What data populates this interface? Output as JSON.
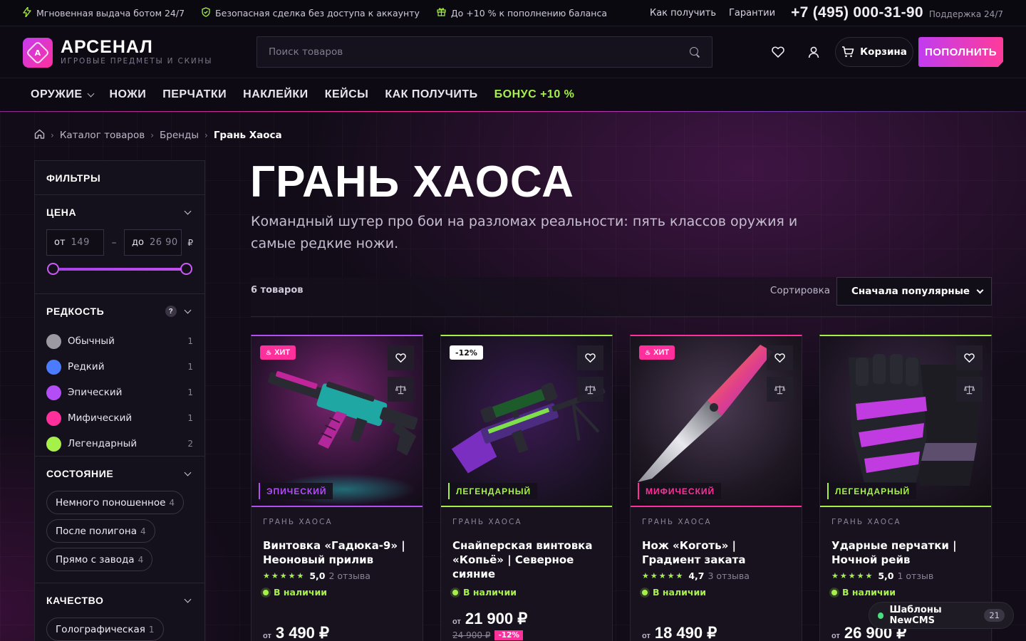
{
  "topbar": {
    "items": [
      "Мгновенная выдача ботом 24/7",
      "Безопасная сделка без доступа к аккаунту",
      "До +10 % к пополнению баланса"
    ],
    "links": [
      "Как получить",
      "Гарантии"
    ],
    "phone": "+7 (495) 000-31-90",
    "support": "Поддержка 24/7"
  },
  "header": {
    "logo_letter": "A",
    "brand": "АРСЕНАЛ",
    "tagline": "ИГРОВЫЕ ПРЕДМЕТЫ И СКИНЫ",
    "search_placeholder": "Поиск товаров",
    "cart_label": "Корзина",
    "topup_label": "ПОПОЛНИТЬ"
  },
  "nav": {
    "items": [
      "ОРУЖИЕ",
      "НОЖИ",
      "ПЕРЧАТКИ",
      "НАКЛЕЙКИ",
      "КЕЙСЫ",
      "КАК ПОЛУЧИТЬ"
    ],
    "bonus": "БОНУС +10 %"
  },
  "breadcrumb": [
    "Каталог товаров",
    "Бренды",
    "Грань Хаоса"
  ],
  "sidebar": {
    "title": "ФИЛЬТРЫ",
    "price": {
      "title": "ЦЕНА",
      "from_label": "от",
      "from_value": "149",
      "to_label": "до",
      "to_value": "26 90",
      "currency": "₽",
      "range_fraction": [
        0.0,
        1.0
      ]
    },
    "rarity": {
      "title": "РЕДКОСТЬ",
      "help": "?",
      "items": [
        {
          "label": "Обычный",
          "count": "1",
          "color": "#9c99a3"
        },
        {
          "label": "Редкий",
          "count": "1",
          "color": "#4b7bff"
        },
        {
          "label": "Эпический",
          "count": "1",
          "color": "#b34df5"
        },
        {
          "label": "Мифический",
          "count": "1",
          "color": "#ff2f9c"
        },
        {
          "label": "Легендарный",
          "count": "2",
          "color": "#a6f04a"
        }
      ]
    },
    "condition": {
      "title": "СОСТОЯНИЕ",
      "items": [
        {
          "label": "Немного поношенное",
          "count": "4"
        },
        {
          "label": "После полигона",
          "count": "4"
        },
        {
          "label": "Прямо с завода",
          "count": "4"
        }
      ]
    },
    "quality": {
      "title": "КАЧЕСТВО",
      "items": [
        {
          "label": "Голографическая",
          "count": "1"
        }
      ]
    }
  },
  "main": {
    "title": "ГРАНЬ ХАОСА",
    "description": "Командный шутер про бои на разломах реальности: пять классов оружия и самые редкие ножи.",
    "count": "6 товаров",
    "sort_label": "Сортировка",
    "sort_value": "Сначала популярные"
  },
  "products": [
    {
      "badge": "ХИТ",
      "badge_type": "hit",
      "rarity": "ЭПИЧЕСКИЙ",
      "rarity_color": "#b34df5",
      "brand": "ГРАНЬ ХАОСА",
      "name": "Винтовка «Гадюка-9» | Неоновый прилив",
      "stars": "★★★★★",
      "rating": "5,0",
      "reviews": "2 отзыва",
      "stock": "В наличии",
      "price_from": "от",
      "price": "3 490 ₽"
    },
    {
      "badge": "-12%",
      "badge_type": "discount",
      "rarity": "ЛЕГЕНДАРНЫЙ",
      "rarity_color": "#a6f04a",
      "brand": "ГРАНЬ ХАОСА",
      "name": "Снайперская винтовка «Копьё» | Северное сияние",
      "stock": "В наличии",
      "price_from": "от",
      "price": "21 900 ₽",
      "old_price": "24 900 ₽",
      "discount": "-12%"
    },
    {
      "badge": "ХИТ",
      "badge_type": "hit",
      "rarity": "МИФИЧЕСКИЙ",
      "rarity_color": "#ff2f9c",
      "brand": "ГРАНЬ ХАОСА",
      "name": "Нож «Коготь» | Градиент заката",
      "stars": "★★★★★",
      "rating": "4,7",
      "reviews": "3 отзыва",
      "stock": "В наличии",
      "price_from": "от",
      "price": "18 490 ₽"
    },
    {
      "rarity": "ЛЕГЕНДАРНЫЙ",
      "rarity_color": "#a6f04a",
      "brand": "ГРАНЬ ХАОСА",
      "name": "Ударные перчатки | Ночной рейв",
      "stars": "★★★★★",
      "rating": "5,0",
      "reviews": "1 отзыв",
      "stock": "В наличии",
      "price_from": "от",
      "price": "26 900 ₽"
    }
  ],
  "widget": {
    "label": "Шаблоны NewCMS",
    "count": "21"
  },
  "colors": {
    "accent_pink": "#ff2f9c",
    "accent_purple": "#c13cf0",
    "accent_green": "#a6f04a",
    "background": "#0d0a12"
  }
}
